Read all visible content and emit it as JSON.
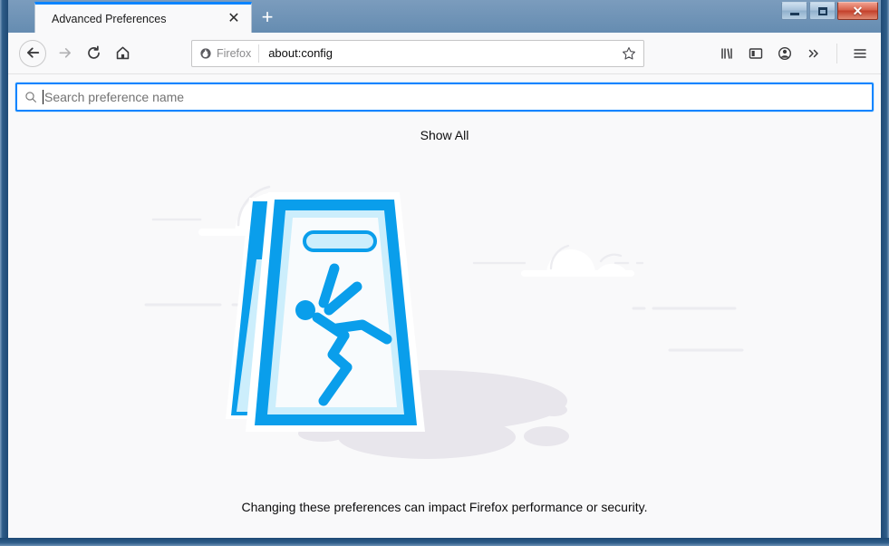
{
  "window": {
    "title": "Advanced Preferences",
    "controls": {
      "minimize_label": "Minimize",
      "maximize_label": "Maximize",
      "close_label": "✕"
    }
  },
  "tabs": {
    "active": {
      "label": "Advanced Preferences",
      "close_glyph": "✕"
    },
    "new_tab_glyph": "+"
  },
  "toolbar": {
    "back_label": "Back",
    "forward_label": "Forward",
    "reload_label": "Reload",
    "home_label": "Home",
    "library_label": "Library",
    "sidebar_label": "Sidebar",
    "account_label": "Account",
    "overflow_label": "More tools",
    "menu_label": "Open application menu"
  },
  "urlbar": {
    "identity_label": "Firefox",
    "url": "about:config",
    "bookmark_label": "Bookmark this page"
  },
  "page": {
    "search": {
      "placeholder": "Search preference name",
      "value": ""
    },
    "show_all_label": "Show All",
    "warning_text": "Changing these preferences can impact Firefox performance or security.",
    "illustration_name": "wet-floor-caution-sign"
  },
  "colors": {
    "accent_blue": "#0a9eeb",
    "focus_blue": "#0a84ff",
    "sign_light": "#d7f0fd",
    "page_background": "#f9f9fa",
    "cloud": "#ffffff",
    "shadow": "#e8e6ec",
    "text": "#0c0c0d",
    "placeholder": "#737373",
    "title_bar": "#3c678f",
    "close_button_red": "#c33f2a"
  }
}
